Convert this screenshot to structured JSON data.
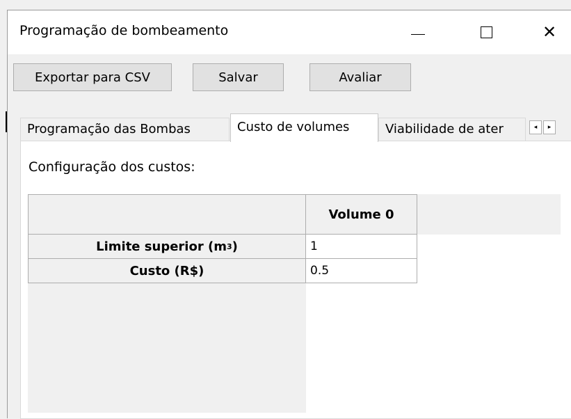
{
  "window": {
    "title": "Programação de bombeamento",
    "minimize_icon": "minimize-icon",
    "maximize_icon": "maximize-icon",
    "close_icon": "close-icon",
    "close_glyph": "✕"
  },
  "toolbar": {
    "export_label": "Exportar para CSV",
    "save_label": "Salvar",
    "evaluate_label": "Avaliar"
  },
  "tabs": [
    {
      "label": "Programação das Bombas",
      "selected": false
    },
    {
      "label": "Custo de volumes",
      "selected": true
    },
    {
      "label": "Viabilidade de ater",
      "selected": false
    }
  ],
  "tab_scroll": {
    "left_glyph": "◂",
    "right_glyph": "▸"
  },
  "panel": {
    "config_label": "Configuração dos custos:",
    "table": {
      "column_header": "Volume 0",
      "rows": [
        {
          "header": "Limite superior (m",
          "header_sup": "3",
          "header_suffix": ")",
          "value": "1"
        },
        {
          "header": "Custo (R$)",
          "value": "0.5"
        }
      ]
    }
  }
}
